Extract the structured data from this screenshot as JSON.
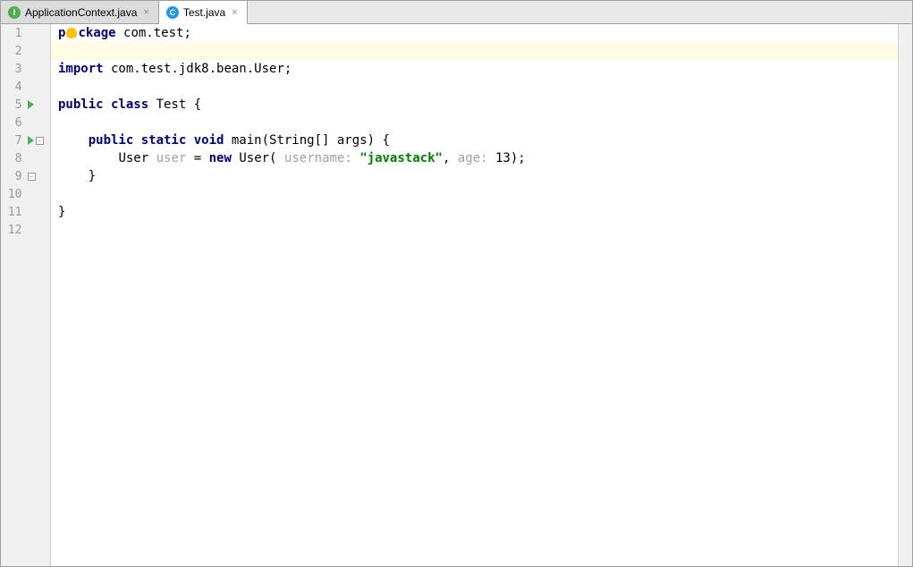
{
  "tabs": [
    {
      "label": "ApplicationContext.java",
      "iconType": "interface",
      "iconLetter": "I",
      "active": false
    },
    {
      "label": "Test.java",
      "iconType": "class",
      "iconLetter": "C",
      "active": true
    }
  ],
  "lines": {
    "count": 12,
    "l1": {
      "kw": "p",
      "kw2": "ckage",
      "pkg": " com.test;"
    },
    "l3": {
      "kw": "import",
      "pkg": " com.test.jdk8.bean.User;"
    },
    "l5": {
      "pre": "public class ",
      "name": "Test {"
    },
    "l7": {
      "indent": "    ",
      "mods": "public static void ",
      "sig": "main(String[] args) {"
    },
    "l8": {
      "indent": "        ",
      "p1": "User ",
      "var": "user",
      "p2": " = ",
      "kwNew": "new",
      "p3": " User( ",
      "h1": "username: ",
      "str": "\"javastack\"",
      "p4": ", ",
      "h2": "age: ",
      "num": "13",
      "p5": ");"
    },
    "l9": {
      "text": "    }"
    },
    "l11": {
      "text": "}"
    }
  },
  "gutter": {
    "runLines": [
      5,
      7
    ],
    "foldOpenLines": [
      7
    ],
    "foldCloseLines": [
      9
    ]
  }
}
